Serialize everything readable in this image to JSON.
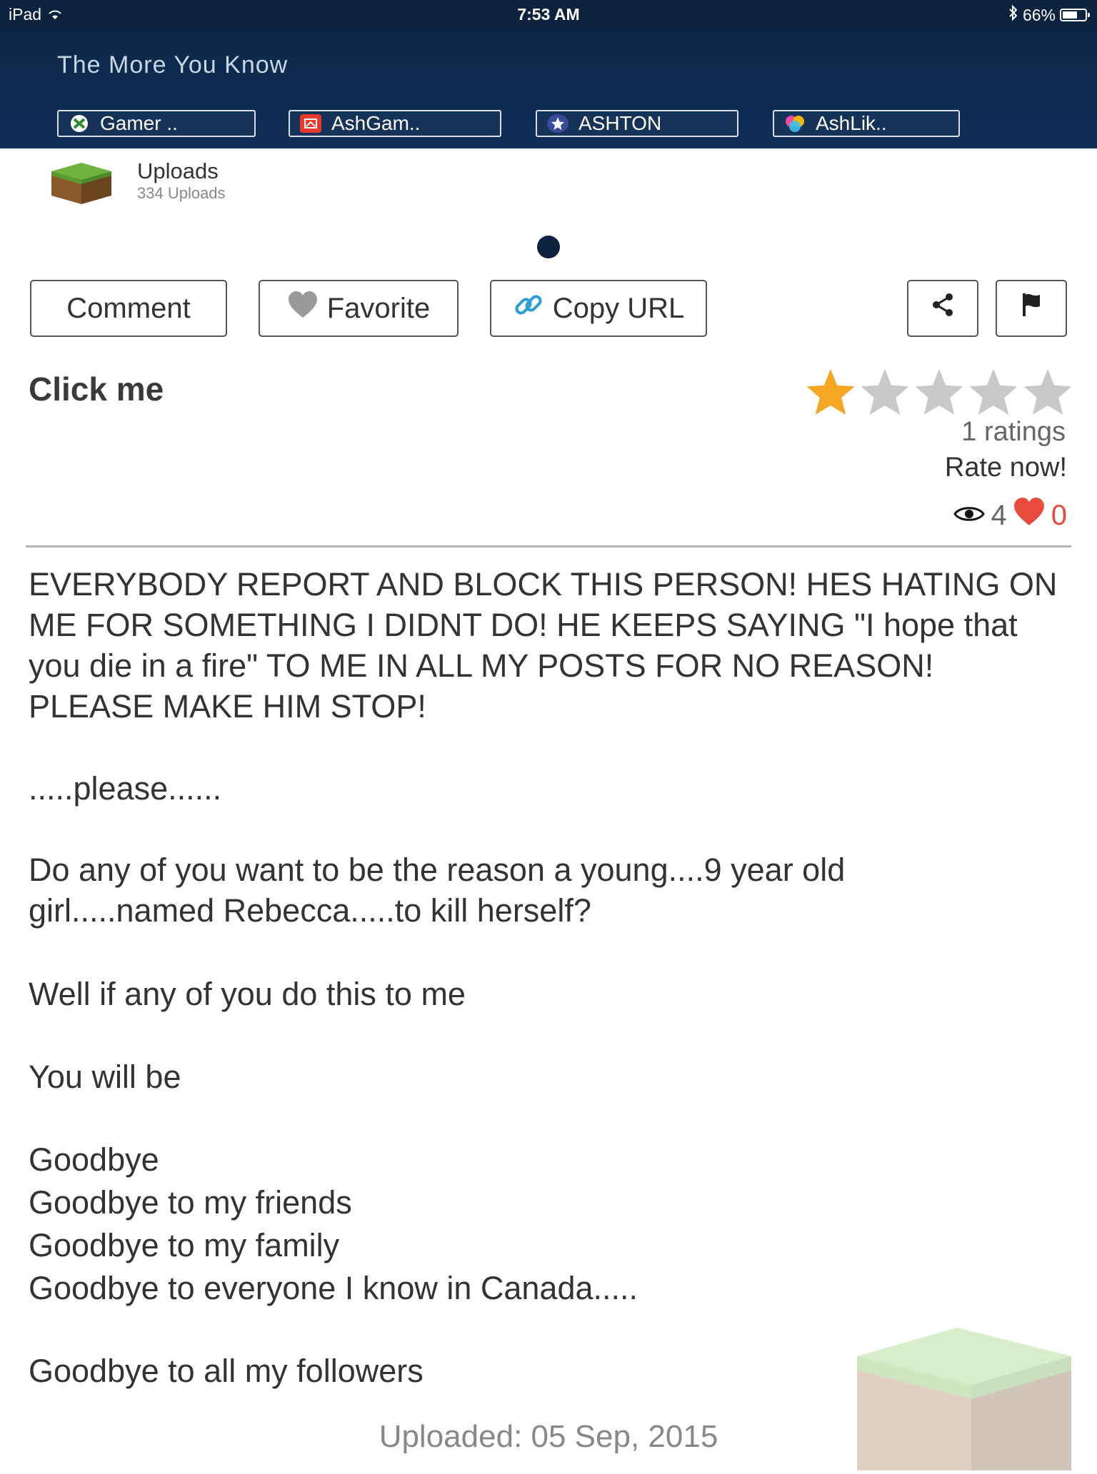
{
  "status_bar": {
    "device": "iPad",
    "time": "7:53 AM",
    "battery": "66%",
    "battery_level": 0.66
  },
  "header": {
    "title": "The More You Know",
    "chips": [
      {
        "label": "Gamer ..",
        "icon": "xbox-icon"
      },
      {
        "label": "AshGam..",
        "icon": "game-center-icon"
      },
      {
        "label": "ASHTON",
        "icon": "star-badge-icon"
      },
      {
        "label": "AshLik..",
        "icon": "colorful-bubbles-icon"
      }
    ]
  },
  "uploads": {
    "title": "Uploads",
    "count": "334 Uploads"
  },
  "actions": {
    "comment": "Comment",
    "favorite": "Favorite",
    "copy_url": "Copy URL"
  },
  "post": {
    "title": "Click me",
    "rating_stars": 1,
    "rating_max": 5,
    "ratings_text": "1 ratings",
    "rate_now": "Rate now!",
    "views": "4",
    "likes": "0",
    "uploaded": "Uploaded: 05 Sep, 2015"
  },
  "body": {
    "p1_l1": "EVERYBODY REPORT AND BLOCK THIS PERSON! HES HATING ON",
    "p1_l2": "ME FOR SOMETHING I DIDNT DO! HE KEEPS SAYING \"I hope that",
    "p1_l3": "you die in a fire\" TO ME IN ALL MY POSTS FOR NO REASON!",
    "p1_l4": "PLEASE MAKE HIM STOP!",
    "p2": ".....please......",
    "p3_l1": "Do any of you want to be the reason a young....9 year old",
    "p3_l2": "girl.....named Rebecca.....to kill herself?",
    "p4": "Well if any of you do this to me",
    "p5": "You will be",
    "p6_l1": "Goodbye",
    "p6_l2": "Goodbye to my friends",
    "p6_l3": "Goodbye to my family",
    "p6_l4": "Goodbye to everyone I know in Canada.....",
    "p7": "Goodbye to all my followers"
  },
  "colors": {
    "navy": "#0c2340",
    "star_active": "#f5a623",
    "star_inactive": "#c8c8c8",
    "heart": "#e84a3c",
    "link_blue": "#2a9fd6"
  }
}
